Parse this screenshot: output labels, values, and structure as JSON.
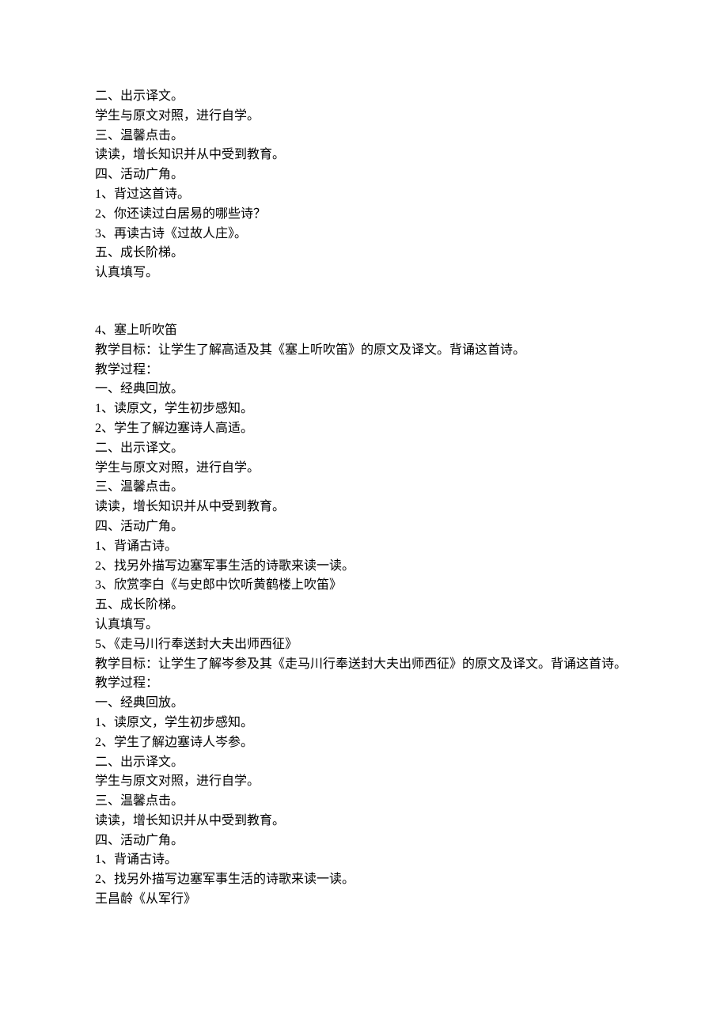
{
  "top_block": [
    "二、出示译文。",
    "学生与原文对照，进行自学。",
    "三、温馨点击。",
    "读读，增长知识并从中受到教育。",
    "四、活动广角。",
    "1、背过这首诗。",
    "2、你还读过白居易的哪些诗？",
    "3、再读古诗《过故人庄》。",
    "五、成长阶梯。",
    "认真填写。"
  ],
  "lesson4": {
    "title": "4、塞上听吹笛",
    "objective": "教学目标：让学生了解高适及其《塞上听吹笛》的原文及译文。背诵这首诗。",
    "process_label": "教学过程：",
    "steps": [
      "一、经典回放。",
      "1、读原文，学生初步感知。",
      "2、学生了解边塞诗人高适。",
      "二、出示译文。",
      "学生与原文对照，进行自学。",
      "三、温馨点击。",
      "读读，增长知识并从中受到教育。",
      "四、活动广角。",
      "1、背诵古诗。",
      "2、找另外描写边塞军事生活的诗歌来读一读。",
      "3、欣赏李白《与史郎中饮听黄鹤楼上吹笛》",
      "五、成长阶梯。",
      "认真填写。"
    ]
  },
  "lesson5": {
    "title": "5、《走马川行奉送封大夫出师西征》",
    "objective": "教学目标：让学生了解岑参及其《走马川行奉送封大夫出师西征》的原文及译文。背诵这首诗。",
    "process_label": "教学过程：",
    "steps": [
      "一、经典回放。",
      "1、读原文，学生初步感知。",
      "2、学生了解边塞诗人岑参。",
      "二、出示译文。",
      "学生与原文对照，进行自学。",
      "三、温馨点击。",
      "读读，增长知识并从中受到教育。",
      "四、活动广角。",
      "1、背诵古诗。",
      "2、找另外描写边塞军事生活的诗歌来读一读。",
      "王昌龄《从军行》"
    ]
  }
}
